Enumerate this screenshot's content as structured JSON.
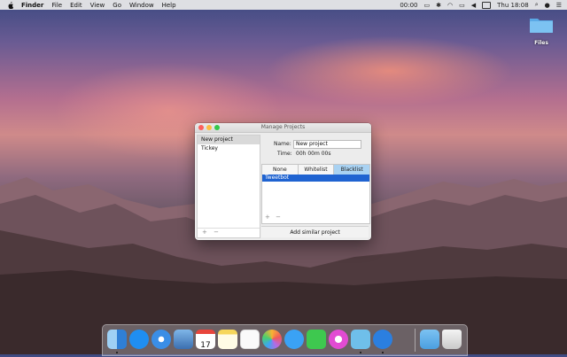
{
  "menubar": {
    "app": "Finder",
    "items": [
      "File",
      "Edit",
      "View",
      "Go",
      "Window",
      "Help"
    ],
    "timer": "00:00",
    "clock": "Thu 18:08"
  },
  "desktop": {
    "folder_label": "Files"
  },
  "window": {
    "title": "Manage Projects",
    "projects": [
      "New project",
      "Tickey"
    ],
    "name_label": "Name:",
    "name_value": "New project",
    "time_label": "Time:",
    "time_value": "00h 00m 00s",
    "tabs": [
      "None",
      "Whitelist",
      "Blacklist"
    ],
    "active_tab": "Blacklist",
    "list_items": [
      "Tweetbot"
    ],
    "add_symbol": "+",
    "remove_symbol": "−",
    "add_similar_label": "Add similar project"
  },
  "dock": {
    "apps": [
      "finder-icon",
      "app-store-icon",
      "safari-icon",
      "preview-icon",
      "calendar-icon",
      "notes-icon",
      "reminders-icon",
      "photos-icon",
      "messages-icon",
      "facetime-icon",
      "itunes-icon",
      "tweetbot-icon",
      "tickey-icon",
      "downloads-folder-icon",
      "trash-icon"
    ],
    "calendar_day": "17"
  }
}
